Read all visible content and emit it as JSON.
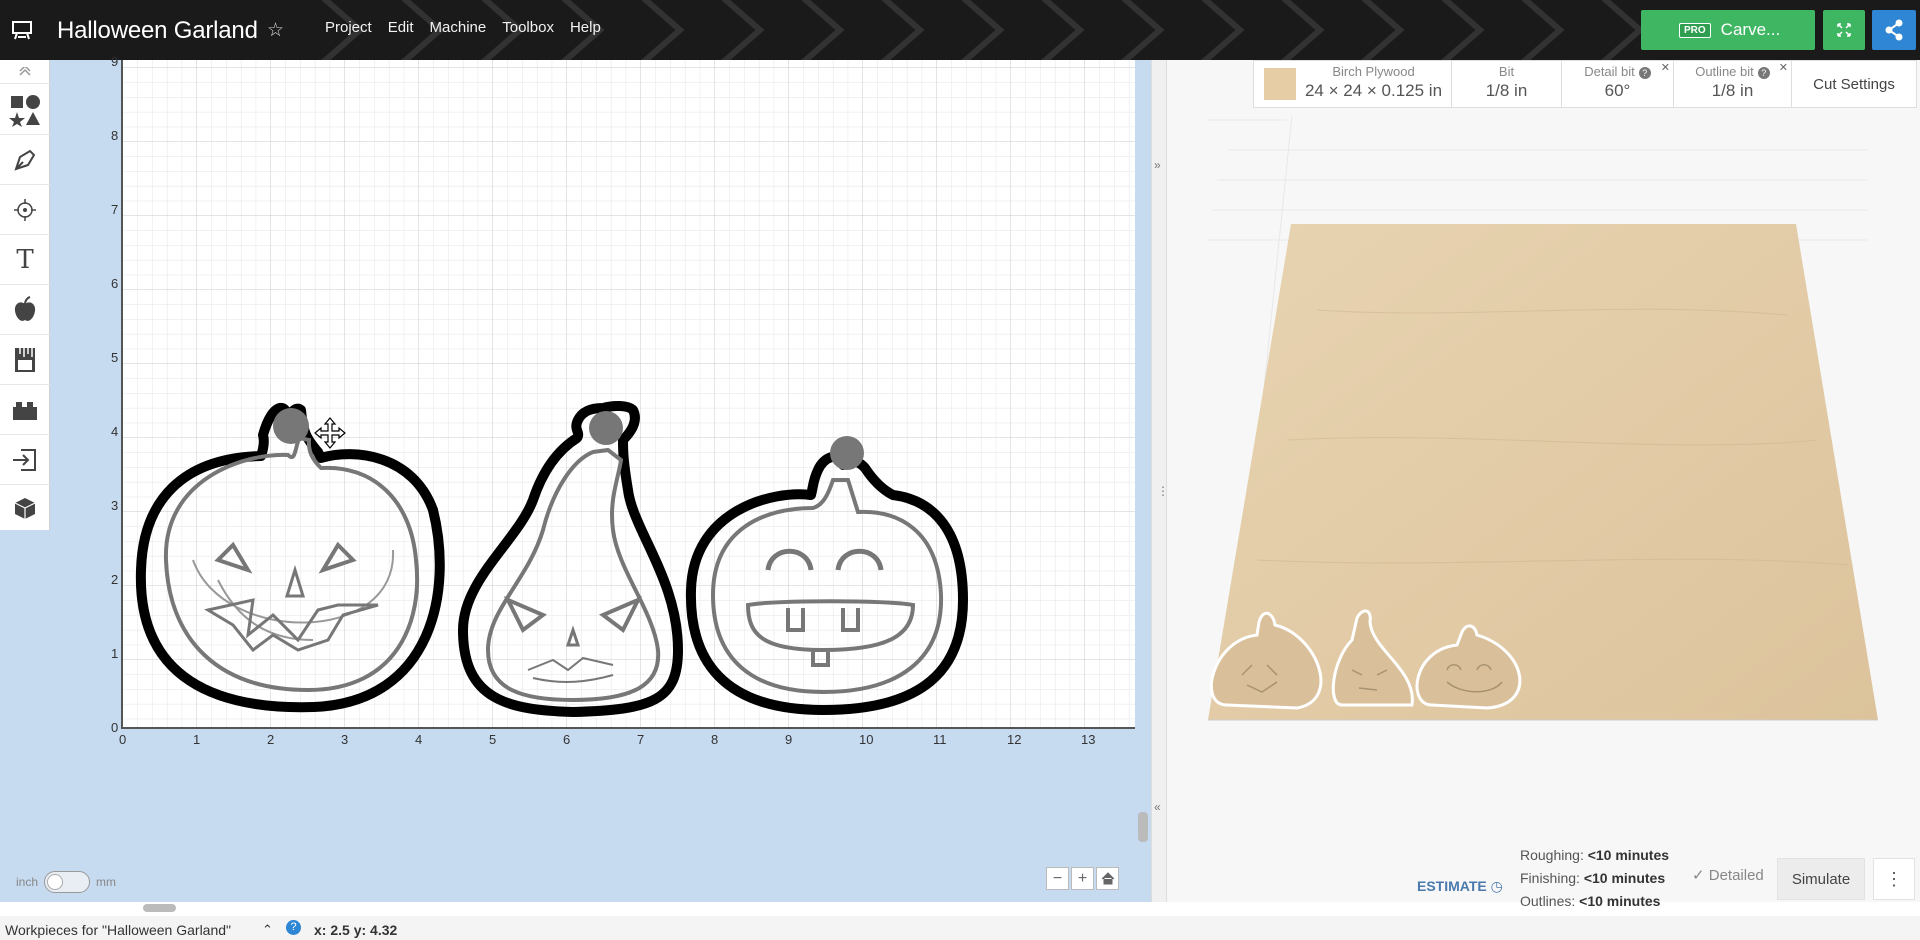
{
  "app": {
    "title": "Halloween Garland",
    "menu": [
      "Project",
      "Edit",
      "Machine",
      "Toolbox",
      "Help"
    ],
    "carve_badge": "PRO",
    "carve_label": "Carve..."
  },
  "material_bar": {
    "material_name": "Birch Plywood",
    "material_size": "24 × 24 × 0.125 in",
    "bit_label": "Bit",
    "bit_value": "1/8 in",
    "detail_bit_label": "Detail bit",
    "detail_bit_value": "60°",
    "outline_bit_label": "Outline bit",
    "outline_bit_value": "1/8 in",
    "cut_settings": "Cut Settings",
    "swatch_color": "#e6cda6"
  },
  "canvas": {
    "x_ticks": [
      "0",
      "1",
      "2",
      "3",
      "4",
      "5",
      "6",
      "7",
      "8",
      "9",
      "10",
      "11",
      "12",
      "13"
    ],
    "y_ticks": [
      "0",
      "1",
      "2",
      "3",
      "4",
      "5",
      "6",
      "7",
      "8",
      "9"
    ]
  },
  "units": {
    "left": "inch",
    "right": "mm"
  },
  "estimate": {
    "label": "ESTIMATE",
    "roughing_label": "Roughing:",
    "roughing_value": "<10 minutes",
    "finishing_label": "Finishing:",
    "finishing_value": "<10 minutes",
    "outlines_label": "Outlines:",
    "outlines_value": "<10 minutes",
    "detailed": "✓ Detailed",
    "simulate": "Simulate"
  },
  "status": {
    "workpieces": "Workpieces for \"Halloween Garland\"",
    "coords": "x: 2.5 y: 4.32"
  },
  "icons": [
    "menu-icon",
    "star-icon",
    "expand-icon",
    "share-icon",
    "shapes-icon",
    "pen-icon",
    "target-icon",
    "text-icon",
    "apple-icon",
    "ruler-icon",
    "blocks-icon",
    "import-icon",
    "cube-icon",
    "move-cursor-icon",
    "clock-icon",
    "help-icon",
    "home-icon"
  ]
}
